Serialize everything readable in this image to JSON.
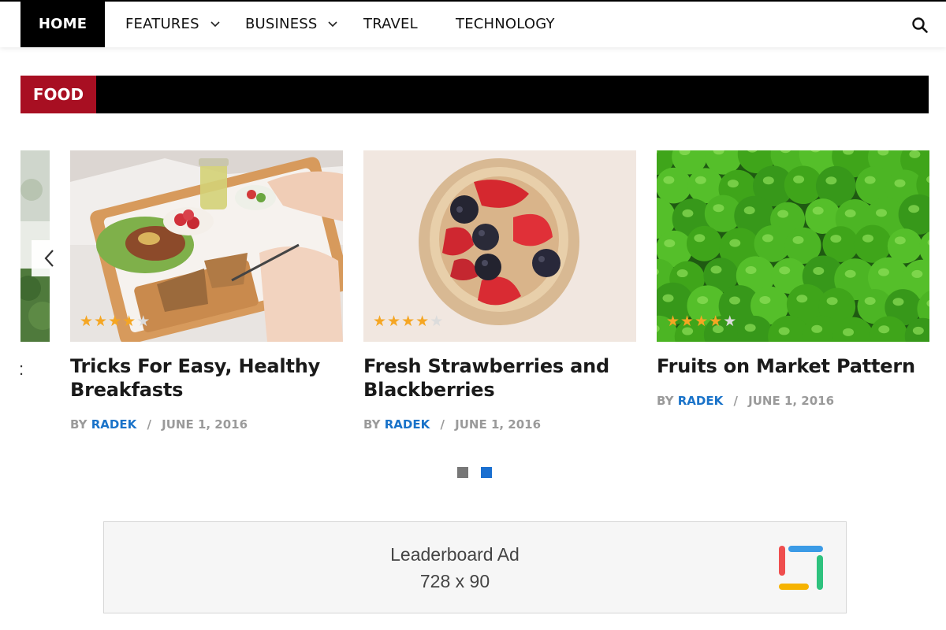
{
  "nav": {
    "items": [
      {
        "label": "HOME",
        "active": true
      },
      {
        "label": "FEATURES",
        "dropdown": true
      },
      {
        "label": "BUSINESS",
        "dropdown": true
      },
      {
        "label": "TRAVEL"
      },
      {
        "label": "TECHNOLOGY"
      }
    ],
    "search_icon": "search-icon"
  },
  "section": {
    "label": "FOOD"
  },
  "cards": [
    {
      "title": "Tricks For Easy, Healthy Breakfasts",
      "by": "BY",
      "author": "RADEK",
      "date": "JUNE 1, 2016",
      "rating": 4,
      "rating_max": 5
    },
    {
      "title": "Fresh Strawberries and Blackberries",
      "by": "BY",
      "author": "RADEK",
      "date": "JUNE 1, 2016",
      "rating": 4,
      "rating_max": 5
    },
    {
      "title": "Fruits on Market Pattern",
      "by": "BY",
      "author": "RADEK",
      "date": "JUNE 1, 2016",
      "rating": 4,
      "rating_max": 5
    }
  ],
  "partial_card": {
    "text": ":"
  },
  "pagination": {
    "pages": 2,
    "active_index": 1
  },
  "ad": {
    "title": "Leaderboard Ad",
    "size": "728 x 90"
  },
  "colors": {
    "accent_red": "#a80f22",
    "link_blue": "#1a73c9",
    "star": "#f5a623",
    "dot_inactive": "#777777",
    "dot_active": "#1a6fd0"
  }
}
